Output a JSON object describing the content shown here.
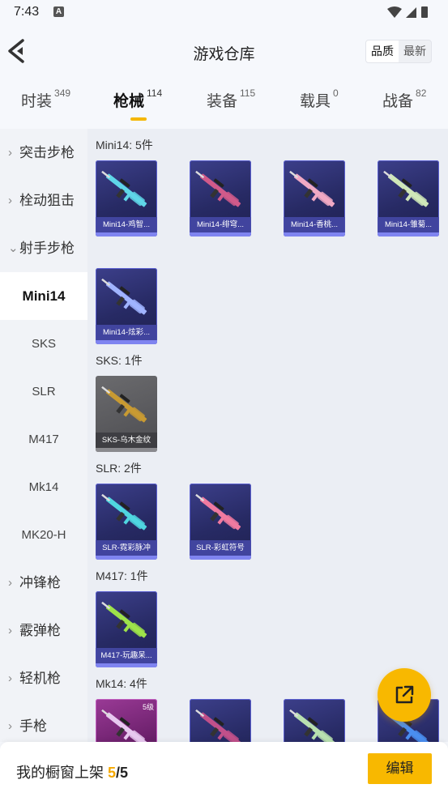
{
  "status_bar": {
    "time": "7:43",
    "notif_icon_letter": "A"
  },
  "header": {
    "title": "游戏仓库",
    "sort_options": [
      "品质",
      "最新"
    ],
    "active_sort": 0
  },
  "tabs": [
    {
      "label": "时装",
      "count": "349"
    },
    {
      "label": "枪械",
      "count": "114"
    },
    {
      "label": "装备",
      "count": "115"
    },
    {
      "label": "载具",
      "count": "0"
    },
    {
      "label": "战备",
      "count": "82"
    }
  ],
  "active_tab": 1,
  "sidebar": [
    {
      "label": "突击步枪",
      "kind": "category",
      "expanded": false
    },
    {
      "label": "栓动狙击",
      "kind": "category",
      "expanded": false
    },
    {
      "label": "射手步枪",
      "kind": "category",
      "expanded": true
    },
    {
      "label": "Mini14",
      "kind": "sub",
      "selected": true
    },
    {
      "label": "SKS",
      "kind": "sub"
    },
    {
      "label": "SLR",
      "kind": "sub"
    },
    {
      "label": "M417",
      "kind": "sub"
    },
    {
      "label": "Mk14",
      "kind": "sub"
    },
    {
      "label": "MK20-H",
      "kind": "sub"
    },
    {
      "label": "冲锋枪",
      "kind": "category",
      "expanded": false
    },
    {
      "label": "霰弹枪",
      "kind": "category",
      "expanded": false
    },
    {
      "label": "轻机枪",
      "kind": "category",
      "expanded": false
    },
    {
      "label": "手枪",
      "kind": "category",
      "expanded": false
    }
  ],
  "groups": [
    {
      "title": "Mini14: 5件",
      "items": [
        {
          "name": "Mini14-鸡智...",
          "style": "purple",
          "gun_color": "#5fd6e8"
        },
        {
          "name": "Mini14-绯穹...",
          "style": "purple",
          "gun_color": "#d05a8a"
        },
        {
          "name": "Mini14-香桃...",
          "style": "purple",
          "gun_color": "#f0a9c4"
        },
        {
          "name": "Mini14-雏菊...",
          "style": "purple",
          "gun_color": "#cfe7b8"
        },
        {
          "name": "Mini14-炫彩...",
          "style": "purple",
          "gun_color": "#a0b4ff"
        }
      ]
    },
    {
      "title": "SKS: 1件",
      "items": [
        {
          "name": "SKS-乌木金纹",
          "style": "gray",
          "gun_color": "#c89a32"
        }
      ]
    },
    {
      "title": "SLR: 2件",
      "items": [
        {
          "name": "SLR-霓彩脉冲",
          "style": "purple",
          "gun_color": "#4fd6e0"
        },
        {
          "name": "SLR-彩虹符号",
          "style": "purple",
          "gun_color": "#f07aa0"
        }
      ]
    },
    {
      "title": "M417: 1件",
      "items": [
        {
          "name": "M417-玩趣呆...",
          "style": "purple",
          "gun_color": "#9ee34a"
        }
      ]
    },
    {
      "title": "Mk14: 4件",
      "items": [
        {
          "name": "",
          "style": "pink",
          "gun_color": "#e8c8f0",
          "level": "5级"
        },
        {
          "name": "",
          "style": "purple",
          "gun_color": "#c0508a"
        },
        {
          "name": "",
          "style": "purple",
          "gun_color": "#b8e0b0"
        },
        {
          "name": "",
          "style": "purple",
          "gun_color": "#4a8ef0"
        }
      ]
    }
  ],
  "bottom_bar": {
    "label": "我的橱窗上架 ",
    "current": "5",
    "separator": "/",
    "total": "5",
    "edit_label": "编辑"
  },
  "colors": {
    "accent": "#f8b800",
    "card_purple": "#2a2d6b",
    "card_gray": "#5a5a5e"
  }
}
